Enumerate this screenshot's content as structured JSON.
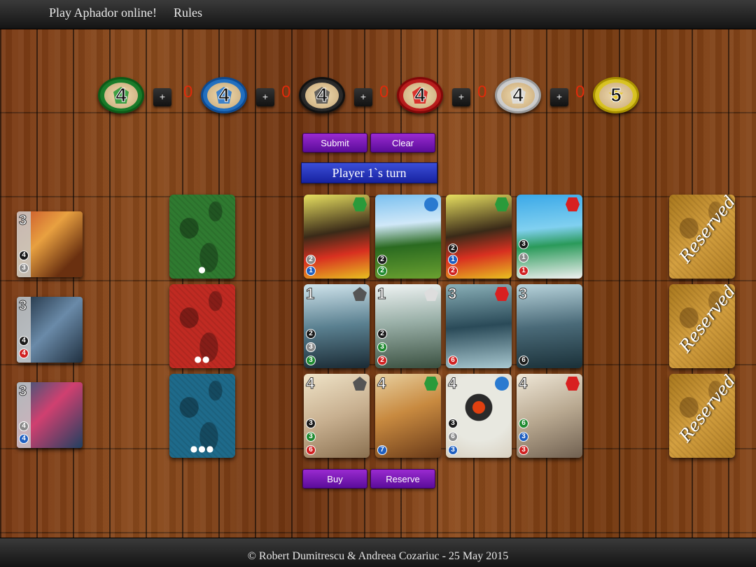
{
  "nav": {
    "play": "Play Aphador online!",
    "rules": "Rules"
  },
  "footer": "© Robert Dumitrescu & Andreea Cozariuc - 25 May 2015",
  "tokens": [
    {
      "color": "green",
      "count": "4",
      "plus": "+",
      "selected": "0"
    },
    {
      "color": "blue",
      "count": "4",
      "plus": "+",
      "selected": "0"
    },
    {
      "color": "black",
      "count": "4",
      "plus": "+",
      "selected": "0"
    },
    {
      "color": "red",
      "count": "4",
      "plus": "+",
      "selected": "0"
    },
    {
      "color": "white",
      "count": "4",
      "plus": "+",
      "selected": "0"
    },
    {
      "color": "gold",
      "count": "5"
    }
  ],
  "actions": {
    "submit": "Submit",
    "clear": "Clear",
    "buy": "Buy",
    "reserve": "Reserve"
  },
  "turn": "Player 1`s turn",
  "decks": [
    {
      "level": 1,
      "dots": "●"
    },
    {
      "level": 2,
      "dots": "●●"
    },
    {
      "level": 3,
      "dots": "●●●"
    }
  ],
  "nobles": [
    {
      "points": "3",
      "cost": [
        "4",
        "3"
      ]
    },
    {
      "points": "3",
      "cost": [
        "4",
        "4"
      ]
    },
    {
      "points": "3",
      "cost": [
        "4",
        "4"
      ]
    }
  ],
  "cards": [
    {
      "points": "",
      "bonus": "green",
      "cost": [
        "2",
        "1"
      ]
    },
    {
      "points": "",
      "bonus": "blue",
      "cost": [
        "2",
        "2"
      ]
    },
    {
      "points": "",
      "bonus": "green",
      "cost": [
        "2",
        "1",
        "2"
      ]
    },
    {
      "points": "",
      "bonus": "red",
      "cost": [
        "3",
        "1",
        "1"
      ]
    },
    {
      "points": "1",
      "bonus": "black",
      "cost": [
        "2",
        "3",
        "3"
      ]
    },
    {
      "points": "1",
      "bonus": "white",
      "cost": [
        "2",
        "3",
        "2"
      ]
    },
    {
      "points": "3",
      "bonus": "red",
      "cost": [
        "6"
      ]
    },
    {
      "points": "3",
      "bonus": "black",
      "cost": [
        "6"
      ]
    },
    {
      "points": "4",
      "bonus": "black",
      "cost": [
        "3",
        "3",
        "6"
      ]
    },
    {
      "points": "4",
      "bonus": "green",
      "cost": [
        "7"
      ]
    },
    {
      "points": "4",
      "bonus": "blue",
      "cost": [
        "3",
        "6",
        "3"
      ]
    },
    {
      "points": "4",
      "bonus": "red",
      "cost": [
        "6",
        "3",
        "3"
      ]
    }
  ],
  "reserved": [
    "Reserved",
    "Reserved",
    "Reserved"
  ],
  "colors": {
    "green": "#1f8a30",
    "blue": "#1f6fc8",
    "black": "#2a2a2a",
    "red": "#c81c1c",
    "white": "#c8c8c8",
    "gold": "#e0c820",
    "accent": "#6a14b0"
  }
}
